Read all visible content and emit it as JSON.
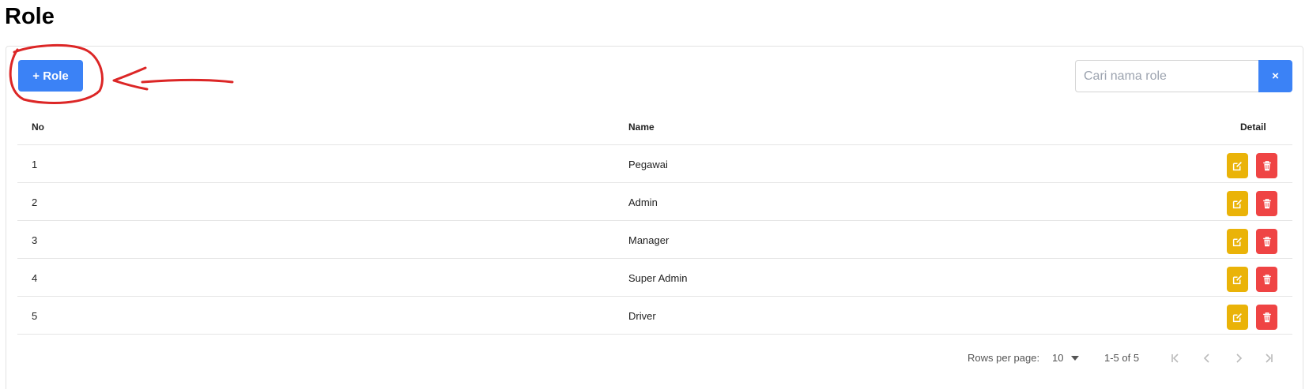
{
  "page": {
    "title": "Role"
  },
  "toolbar": {
    "add_label": "+ Role"
  },
  "search": {
    "placeholder": "Cari nama role",
    "clear_label": "×"
  },
  "table": {
    "headers": {
      "no": "No",
      "name": "Name",
      "detail": "Detail"
    },
    "rows": [
      {
        "no": "1",
        "name": "Pegawai"
      },
      {
        "no": "2",
        "name": "Admin"
      },
      {
        "no": "3",
        "name": "Manager"
      },
      {
        "no": "4",
        "name": "Super Admin"
      },
      {
        "no": "5",
        "name": "Driver"
      }
    ],
    "actions": {
      "edit_icon": "edit-icon",
      "delete_icon": "trash-icon"
    }
  },
  "pagination": {
    "rows_per_page_label": "Rows per page:",
    "rows_per_page_value": "10",
    "range_text": "1-5 of 5"
  },
  "colors": {
    "primary": "#3b82f6",
    "edit": "#eab308",
    "delete": "#ef4444",
    "annotation": "#dc2626"
  }
}
